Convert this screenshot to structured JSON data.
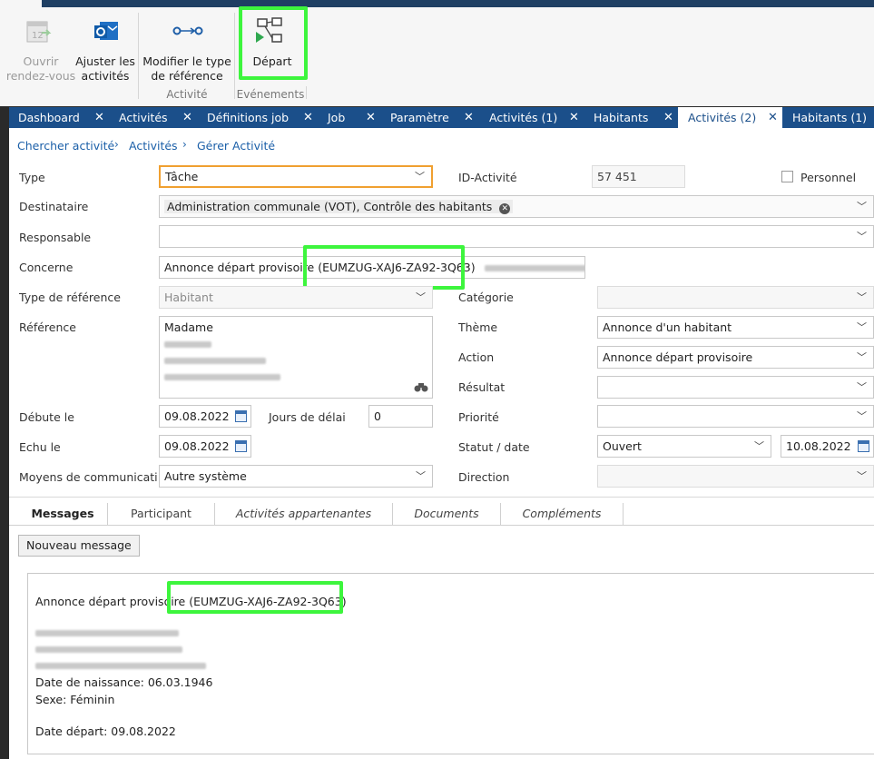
{
  "ribbon": {
    "buttons": [
      {
        "label_line1": "Ouvrir",
        "label_line2": "rendez-vous",
        "icon": "calendar-open-icon",
        "enabled": false
      },
      {
        "label_line1": "Ajuster les",
        "label_line2": "activités",
        "icon": "outlook-icon",
        "enabled": true
      },
      {
        "label_line1": "Modifier le type",
        "label_line2": "de référence",
        "icon": "link-nodes-icon",
        "enabled": true
      },
      {
        "label_line1": "Départ",
        "label_line2": "",
        "icon": "process-flow-icon",
        "enabled": true
      }
    ],
    "groups": [
      "Activité",
      "Evénements"
    ]
  },
  "tabs": [
    {
      "label": "Dashboard"
    },
    {
      "label": "Activités"
    },
    {
      "label": "Définitions job"
    },
    {
      "label": "Job"
    },
    {
      "label": "Paramètre"
    },
    {
      "label": "Activités (1)"
    },
    {
      "label": "Habitants"
    },
    {
      "label": "Activités (2)",
      "active": true
    },
    {
      "label": "Habitants (1)"
    }
  ],
  "breadcrumb": [
    "Chercher activité",
    "Activités",
    "Gérer Activité"
  ],
  "form": {
    "type_label": "Type",
    "type_value": "Tâche",
    "id_label": "ID-Activité",
    "id_value": "57 451",
    "personnel_label": "Personnel",
    "destinataire_label": "Destinataire",
    "destinataire_value": "Administration communale (VOT), Contrôle des habitants",
    "responsable_label": "Responsable",
    "responsable_value": "",
    "concerne_label": "Concerne",
    "concerne_value": "Annonce départ provisoire (EUMZUG-XAJ6-ZA92-3Q63)",
    "type_ref_label": "Type de référence",
    "type_ref_value": "Habitant",
    "categorie_label": "Catégorie",
    "categorie_value": "",
    "reference_label": "Référence",
    "reference_line1": "Madame",
    "theme_label": "Thème",
    "theme_value": "Annonce d'un habitant",
    "action_label": "Action",
    "action_value": "Annonce départ provisoire",
    "resultat_label": "Résultat",
    "resultat_value": "",
    "debute_label": "Débute le",
    "debute_value": "09.08.2022",
    "jours_label": "Jours de délai",
    "jours_value": "0",
    "priorite_label": "Priorité",
    "priorite_value": "",
    "echu_label": "Echu le",
    "echu_value": "09.08.2022",
    "statut_label": "Statut / date",
    "statut_value": "Ouvert",
    "statut_date": "10.08.2022",
    "moyens_label": "Moyens de communicatio",
    "moyens_value": "Autre système",
    "direction_label": "Direction",
    "direction_value": ""
  },
  "bottom_tabs": [
    {
      "label": "Messages",
      "active": true
    },
    {
      "label": "Participant"
    },
    {
      "label": "Activités appartenantes"
    },
    {
      "label": "Documents"
    },
    {
      "label": "Compléments"
    }
  ],
  "new_message_label": "Nouveau message",
  "message": {
    "title": "Annonce départ provisoire (EUMZUG-XAJ6-ZA92-3Q63)",
    "birth": "Date de naissance: 06.03.1946",
    "sex": "Sexe: Féminin",
    "departure": "Date départ: 09.08.2022"
  },
  "colors": {
    "tab_bar": "#1b4f8a",
    "highlight": "#3df53d",
    "focus_border": "#f0a030"
  }
}
